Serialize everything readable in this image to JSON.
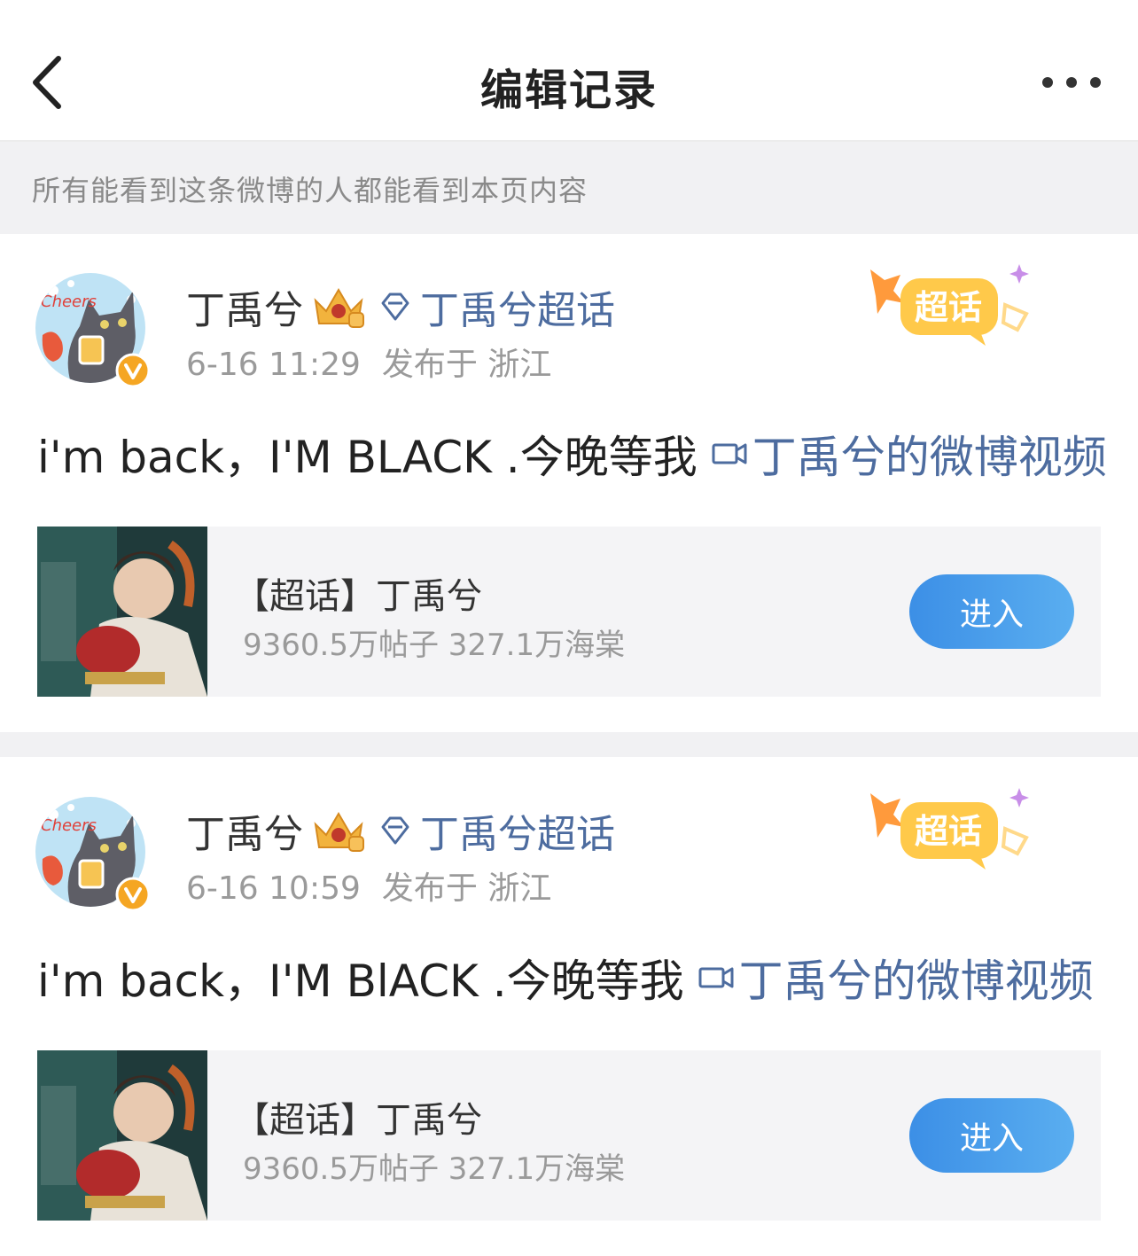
{
  "nav": {
    "title": "编辑记录",
    "back_icon": "chevron-left-icon",
    "more_icon": "more-dots-icon"
  },
  "notice": "所有能看到这条微博的人都能看到本页内容",
  "posts": [
    {
      "username": "丁禹兮",
      "topic_link": "丁禹兮超话",
      "time": "6-16 11:29",
      "location": "发布于 浙江",
      "text": "i'm back，I'M BLACK .今晚等我",
      "video_link": "丁禹兮的微博视频",
      "badge": "超话",
      "card": {
        "title": "【超话】丁禹兮",
        "stats": "9360.5万帖子 327.1万海棠",
        "button": "进入"
      }
    },
    {
      "username": "丁禹兮",
      "topic_link": "丁禹兮超话",
      "time": "6-16 10:59",
      "location": "发布于 浙江",
      "text": "i'm back，I'M BlACK .今晚等我",
      "video_link": "丁禹兮的微博视频",
      "badge": "超话",
      "card": {
        "title": "【超话】丁禹兮",
        "stats": "9360.5万帖子 327.1万海棠",
        "button": "进入"
      }
    }
  ],
  "colors": {
    "link": "#4d6c9f",
    "button_start": "#3c8fe6",
    "button_end": "#5aaef0",
    "verified": "#f5a623",
    "badge": "#ffc94a"
  }
}
